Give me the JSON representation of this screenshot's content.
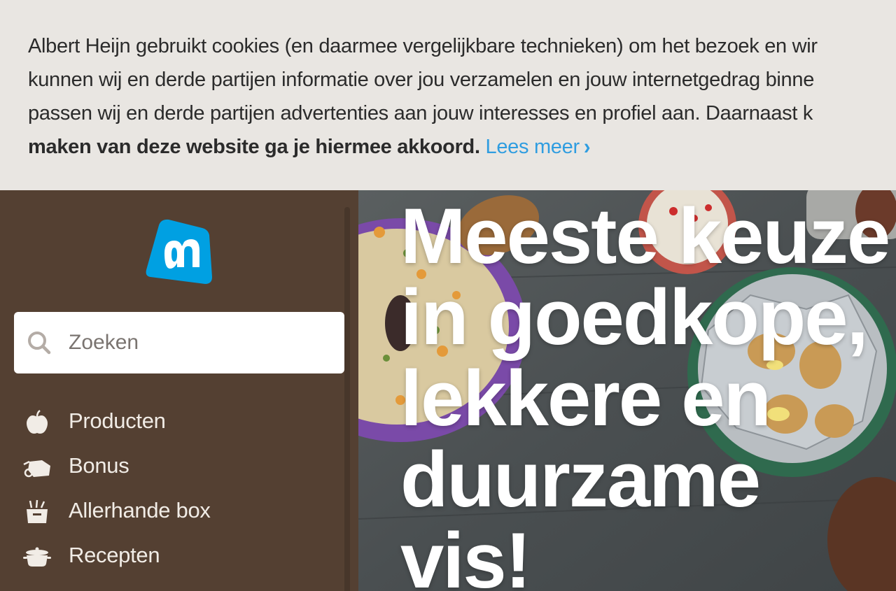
{
  "cookie_banner": {
    "line1": "Albert Heijn gebruikt cookies (en daarmee vergelijkbare technieken) om het bezoek en wir",
    "line2": "kunnen wij en derde partijen informatie over jou verzamelen en jouw internetgedrag binne",
    "line3": "passen wij en derde partijen advertenties aan jouw interesses en profiel aan. Daarnaast k",
    "line4_bold": "maken van deze website ga je hiermee akkoord.",
    "read_more": "Lees meer",
    "read_more_chevron": "›",
    "link_color": "#2f9de0"
  },
  "sidebar": {
    "logo_icon": "albert-heijn-logo",
    "search": {
      "placeholder": "Zoeken",
      "icon": "search-icon"
    },
    "items": [
      {
        "label": "Producten",
        "icon": "apple-icon"
      },
      {
        "label": "Bonus",
        "icon": "price-tag-icon"
      },
      {
        "label": "Allerhande box",
        "icon": "box-icon"
      },
      {
        "label": "Recepten",
        "icon": "cooking-pot-icon"
      }
    ]
  },
  "hero": {
    "title_lines": [
      "Meeste keuze",
      "in goedkope,",
      "lekkere en",
      "duurzame vis!"
    ]
  },
  "colors": {
    "sidebar_bg": "#544032",
    "banner_bg": "#e9e6e2",
    "brand_blue": "#00a0e2"
  }
}
